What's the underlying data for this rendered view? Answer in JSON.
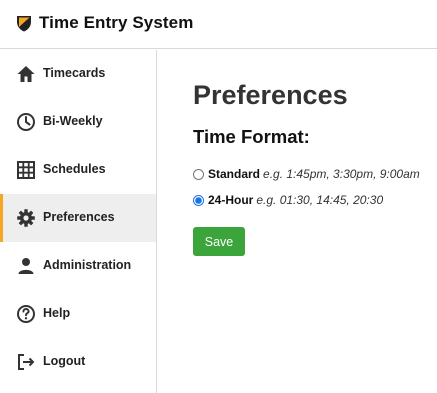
{
  "app": {
    "title": "Time Entry System",
    "logo_icon": "shield-logo"
  },
  "sidebar": {
    "active_accent_color": "#f5a623",
    "items": [
      {
        "label": "Timecards",
        "icon": "home-icon",
        "active": false
      },
      {
        "label": "Bi-Weekly",
        "icon": "clock-icon",
        "active": false
      },
      {
        "label": "Schedules",
        "icon": "grid-icon",
        "active": false
      },
      {
        "label": "Preferences",
        "icon": "gear-icon",
        "active": true
      },
      {
        "label": "Administration",
        "icon": "person-icon",
        "active": false
      },
      {
        "label": "Help",
        "icon": "question-icon",
        "active": false
      },
      {
        "label": "Logout",
        "icon": "logout-icon",
        "active": false
      }
    ]
  },
  "main": {
    "title": "Preferences",
    "section_title": "Time Format:",
    "options": [
      {
        "name": "Standard",
        "example": "e.g. 1:45pm, 3:30pm, 9:00am",
        "selected": false
      },
      {
        "name": "24-Hour",
        "example": "e.g. 01:30, 14:45, 20:30",
        "selected": true
      }
    ],
    "save_label": "Save",
    "save_color": "#3ba53b"
  }
}
